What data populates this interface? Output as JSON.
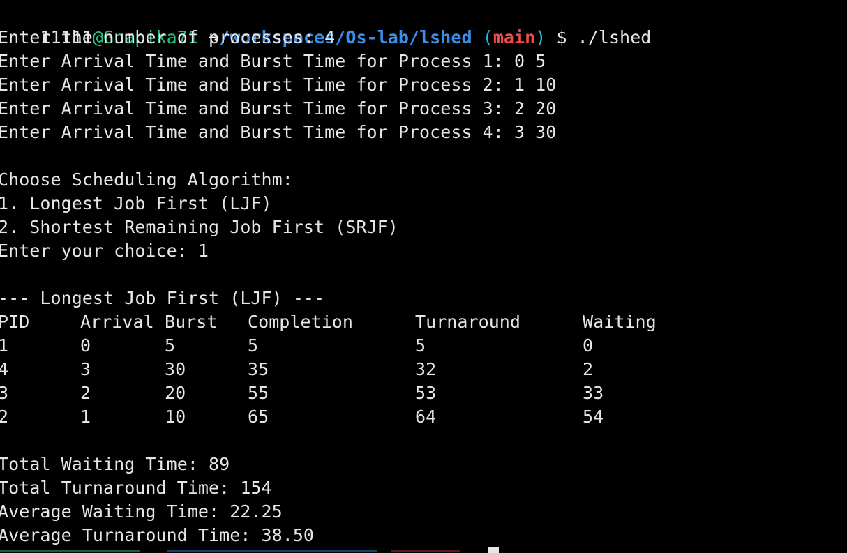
{
  "prompt": {
    "user": "11111",
    "host": "@Gnapika71",
    "arrow": "➜",
    "path": "/workspaces/Os-lab/lshed",
    "paren_open": "(",
    "branch": "main",
    "paren_close": ")",
    "dollar": "$",
    "command": "./lshed"
  },
  "inputs": {
    "num_processes": "Enter the number of processes: 4",
    "process_lines": [
      "Enter Arrival Time and Burst Time for Process 1: 0 5",
      "Enter Arrival Time and Burst Time for Process 2: 1 10",
      "Enter Arrival Time and Burst Time for Process 3: 2 20",
      "Enter Arrival Time and Burst Time for Process 4: 3 30"
    ]
  },
  "menu": {
    "heading": "Choose Scheduling Algorithm:",
    "option_1": "1. Longest Job First (LJF)",
    "option_2": "2. Shortest Remaining Job First (SRJF)",
    "choice": "Enter your choice: 1"
  },
  "results": {
    "title": "--- Longest Job First (LJF) ---",
    "headers": [
      "PID",
      "Arrival",
      "Burst",
      "Completion",
      "Turnaround",
      "Waiting"
    ],
    "rows": [
      [
        "1",
        "0",
        "5",
        "5",
        "5",
        "0"
      ],
      [
        "4",
        "3",
        "30",
        "35",
        "32",
        "2"
      ],
      [
        "3",
        "2",
        "20",
        "55",
        "53",
        "33"
      ],
      [
        "2",
        "1",
        "10",
        "65",
        "64",
        "54"
      ]
    ]
  },
  "summary": {
    "total_waiting": "Total Waiting Time: 89",
    "total_turnaround": "Total Turnaround Time: 154",
    "avg_waiting": "Average Waiting Time: 22.25",
    "avg_turnaround": "Average Turnaround Time: 38.50"
  },
  "colors": {
    "background": "#000000",
    "text": "#e6e6e6",
    "host": "#26c281",
    "path": "#3b8eea",
    "branch": "#f14c4c",
    "paren": "#29b8db"
  }
}
